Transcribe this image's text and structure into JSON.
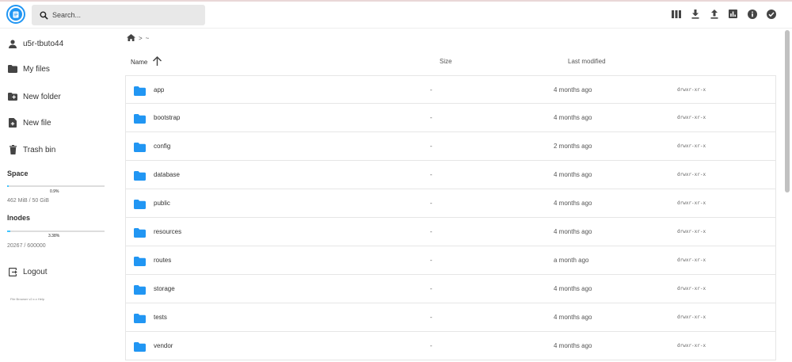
{
  "header": {
    "search_placeholder": "Search...",
    "actions": [
      {
        "name": "switch-view-icon"
      },
      {
        "name": "download-icon"
      },
      {
        "name": "upload-icon"
      },
      {
        "name": "info-chart-icon"
      },
      {
        "name": "info-icon"
      },
      {
        "name": "select-multiple-icon"
      }
    ]
  },
  "sidebar": {
    "user": "u5r-tbuto44",
    "my_files": "My files",
    "new_folder": "New folder",
    "new_file": "New file",
    "trash_bin": "Trash bin",
    "space": {
      "title": "Space",
      "percent_label": "0.9%",
      "fraction": 0.009,
      "text": "462 MiB / 50 GiB"
    },
    "inodes": {
      "title": "Inodes",
      "percent_label": "3.38%",
      "fraction": 0.0338,
      "text": "20267 / 600000"
    },
    "logout": "Logout",
    "version": "File Browser v2.x.x Help"
  },
  "breadcrumb": {
    "separator": ">",
    "current": "~"
  },
  "columns": {
    "name": "Name",
    "size": "Size",
    "modified": "Last modified"
  },
  "files": [
    {
      "name": "app",
      "size": "-",
      "modified": "4 months ago",
      "perm": "drwxr-xr-x"
    },
    {
      "name": "bootstrap",
      "size": "-",
      "modified": "4 months ago",
      "perm": "drwxr-xr-x"
    },
    {
      "name": "config",
      "size": "-",
      "modified": "2 months ago",
      "perm": "drwxr-xr-x"
    },
    {
      "name": "database",
      "size": "-",
      "modified": "4 months ago",
      "perm": "drwxr-xr-x"
    },
    {
      "name": "public",
      "size": "-",
      "modified": "4 months ago",
      "perm": "drwxr-xr-x"
    },
    {
      "name": "resources",
      "size": "-",
      "modified": "4 months ago",
      "perm": "drwxr-xr-x"
    },
    {
      "name": "routes",
      "size": "-",
      "modified": "a month ago",
      "perm": "drwxr-xr-x"
    },
    {
      "name": "storage",
      "size": "-",
      "modified": "4 months ago",
      "perm": "drwxr-xr-x"
    },
    {
      "name": "tests",
      "size": "-",
      "modified": "4 months ago",
      "perm": "drwxr-xr-x"
    },
    {
      "name": "vendor",
      "size": "-",
      "modified": "4 months ago",
      "perm": "drwxr-xr-x"
    }
  ],
  "colors": {
    "accent": "#2196f3",
    "folder": "#2196f3",
    "bar_fill": "#40c4ff"
  }
}
